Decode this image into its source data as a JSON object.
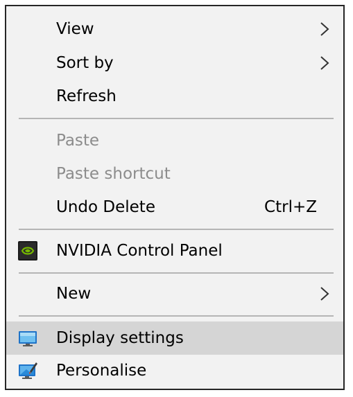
{
  "context_menu": {
    "items": [
      {
        "label": "View",
        "has_submenu": true,
        "enabled": true
      },
      {
        "label": "Sort by",
        "has_submenu": true,
        "enabled": true
      },
      {
        "label": "Refresh",
        "enabled": true
      },
      {
        "label": "Paste",
        "enabled": false
      },
      {
        "label": "Paste shortcut",
        "enabled": false
      },
      {
        "label": "Undo Delete",
        "shortcut": "Ctrl+Z",
        "enabled": true
      },
      {
        "label": "NVIDIA Control Panel",
        "icon": "nvidia-icon",
        "enabled": true
      },
      {
        "label": "New",
        "has_submenu": true,
        "enabled": true
      },
      {
        "label": "Display settings",
        "icon": "display-icon",
        "enabled": true,
        "highlighted": true
      },
      {
        "label": "Personalise",
        "icon": "personalise-icon",
        "enabled": true
      }
    ]
  },
  "colors": {
    "menu_background": "#f2f2f2",
    "highlight": "#d5d5d5",
    "disabled_text": "#8c8c8c",
    "separator": "#b5b5b5",
    "nvidia_green": "#76b900"
  }
}
